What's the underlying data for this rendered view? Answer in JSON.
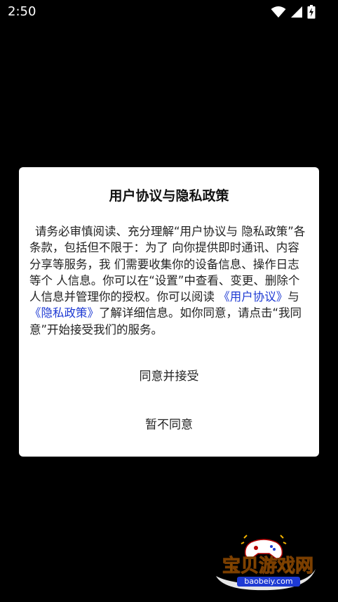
{
  "status_bar": {
    "time": "2:50"
  },
  "dialog": {
    "title": "用户协议与隐私政策",
    "body": {
      "text_1": "请务必审慎阅读、充分理解“用户协议与 隐私政策”各条款，包括但不限于：为了 向你提供即时通讯、内容分享等服务，我 们需要收集你的设备信息、操作日志等个 人信息。你可以在“设置”中查看、变更、删除个人信息并管理你的授权。你可以阅读 ",
      "link_user_agreement": "《用户协议》",
      "text_2": "与 ",
      "link_privacy_policy": "《隐私政策》",
      "text_3": "了解详细信息。如你同意，请点击“我同意”开始接受我们的服务。"
    },
    "agree_label": "同意并接受",
    "disagree_label": "暂不同意"
  },
  "watermark": {
    "brand": "宝贝游戏网",
    "domain": "baobeiy.com"
  },
  "colors": {
    "background": "#000000",
    "dialog_background": "#ffffff",
    "link": "#1e3ad3",
    "watermark_text": "#f5b400"
  },
  "icons": [
    "wifi-icon",
    "signal-icon",
    "battery-charging-icon",
    "gamepad-icon"
  ]
}
